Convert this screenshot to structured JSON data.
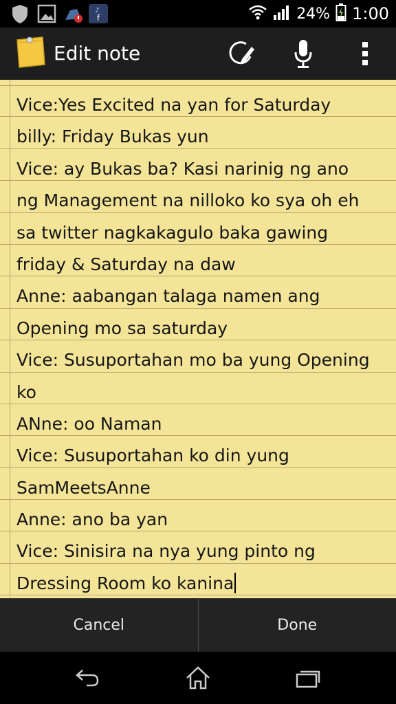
{
  "status_bar": {
    "notification_icons": [
      "shield-icon",
      "gallery-icon",
      "app-update-icon",
      "music-facebook-icon"
    ],
    "battery_percent": "24%",
    "time": "1:00"
  },
  "action_bar": {
    "title": "Edit note",
    "icons": [
      "sticky-note-app-icon",
      "eraser-pen-icon",
      "microphone-icon",
      "overflow-menu-icon"
    ]
  },
  "note": {
    "lines": [
      "Vice:Yes Excited na yan for Saturday",
      "billy: Friday Bukas yun",
      "Vice: ay Bukas ba? Kasi narinig ng ano",
      "ng Management na nilloko ko sya oh eh",
      "sa twitter nagkakagulo baka gawing",
      "friday & Saturday na daw",
      "Anne: aabangan talaga namen ang",
      "Opening mo sa saturday",
      "Vice: Susuportahan mo ba yung Opening",
      "ko",
      "ANne: oo Naman",
      "Vice: Susuportahan ko din yung",
      "SamMeetsAnne",
      "Anne: ano ba yan",
      "Vice: Sinisira na nya yung pinto ng",
      "Dressing Room ko kanina"
    ]
  },
  "buttons": {
    "cancel": "Cancel",
    "done": "Done"
  },
  "nav_bar": {
    "icons": [
      "back-icon",
      "home-icon",
      "recent-apps-icon"
    ]
  },
  "colors": {
    "paper": "#f3e497",
    "rule_line": "#b9a665",
    "action_bar": "#1e1e1e",
    "button_bar": "#232323"
  }
}
